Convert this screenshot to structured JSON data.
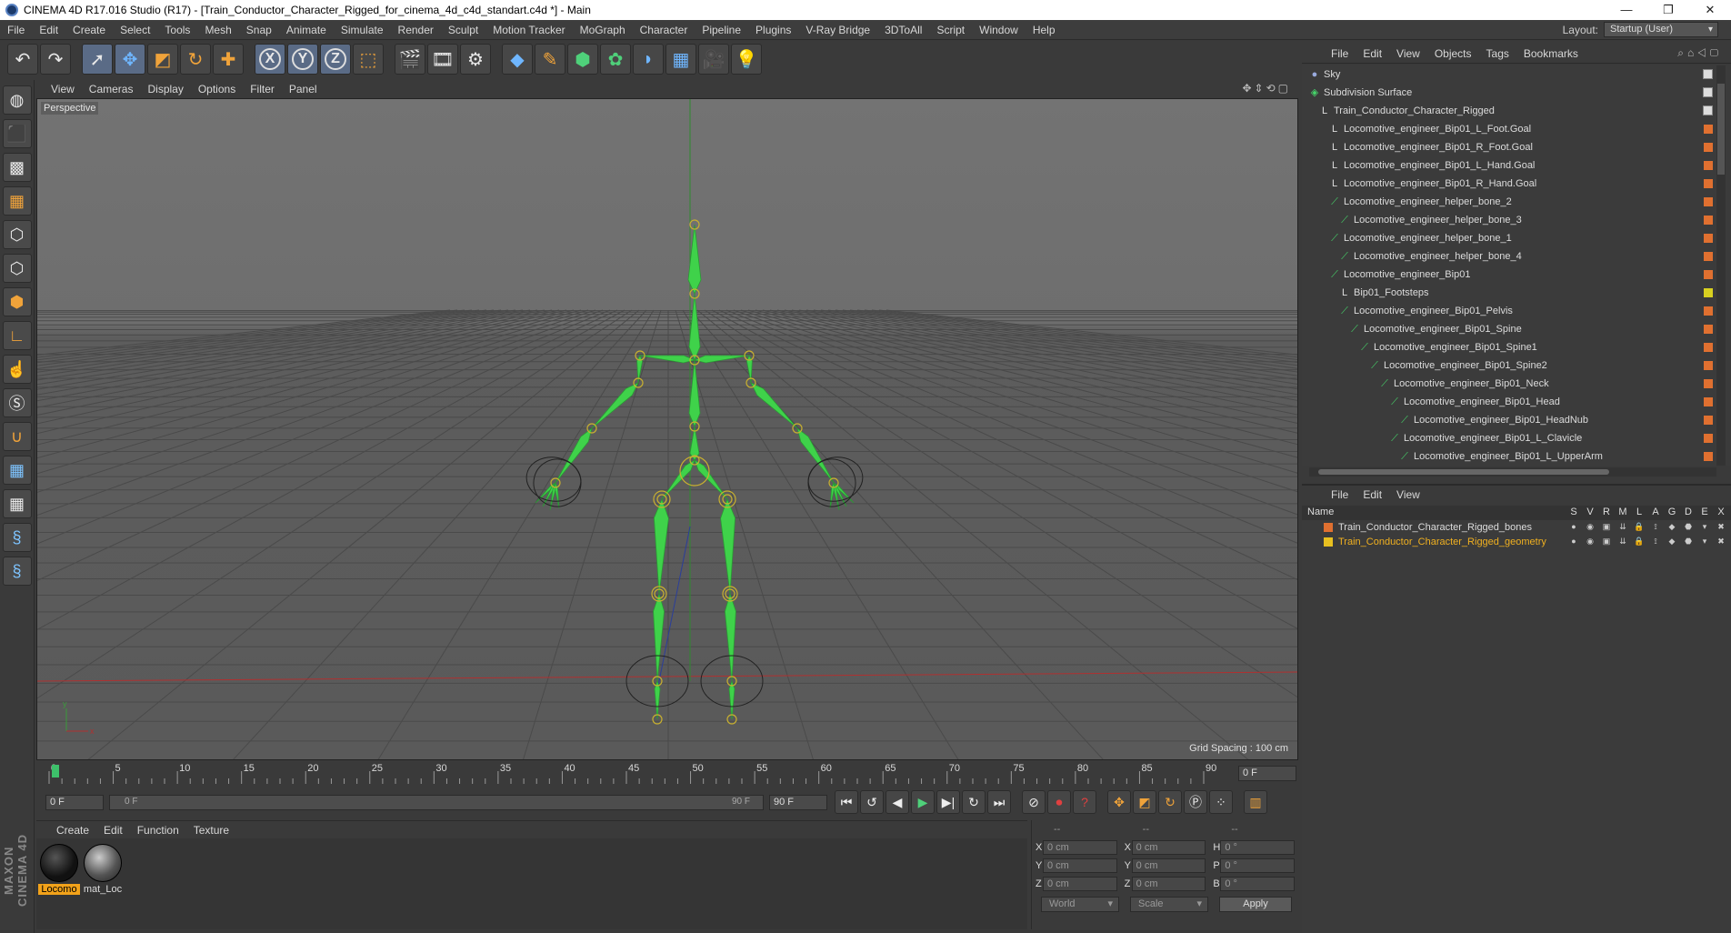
{
  "window": {
    "title": "CINEMA 4D R17.016 Studio (R17) - [Train_Conductor_Character_Rigged_for_cinema_4d_c4d_standart.c4d *] - Main",
    "controls": [
      "—",
      "❐",
      "✕"
    ]
  },
  "menubar": {
    "items": [
      "File",
      "Edit",
      "Create",
      "Select",
      "Tools",
      "Mesh",
      "Snap",
      "Animate",
      "Simulate",
      "Render",
      "Sculpt",
      "Motion Tracker",
      "MoGraph",
      "Character",
      "Pipeline",
      "Plugins",
      "V-Ray Bridge",
      "3DToAll",
      "Script",
      "Window",
      "Help"
    ],
    "layout_label": "Layout:",
    "layout_value": "Startup (User)"
  },
  "toolbar": {
    "icons": [
      "undo-icon",
      "redo-icon",
      "live-selection-icon",
      "move-icon",
      "scale-icon",
      "rotate-icon",
      "add-icon",
      "x-axis-icon",
      "y-axis-icon",
      "z-axis-icon",
      "coordinate-system-icon",
      "render-view-icon",
      "render-picture-viewer-icon",
      "edit-render-settings-icon",
      "cube-icon",
      "pen-icon",
      "subdivision-icon",
      "mograph-cloner-icon",
      "deformer-icon",
      "floor-icon",
      "camera-icon",
      "light-icon"
    ],
    "axis_labels": [
      "X",
      "Y",
      "Z"
    ]
  },
  "viewport": {
    "menu": [
      "View",
      "Cameras",
      "Display",
      "Options",
      "Filter",
      "Panel"
    ],
    "label": "Perspective",
    "grid_spacing": "Grid Spacing : 100 cm"
  },
  "timeline": {
    "ticks": [
      "0",
      "5",
      "10",
      "15",
      "20",
      "25",
      "30",
      "35",
      "40",
      "45",
      "50",
      "55",
      "60",
      "65",
      "70",
      "75",
      "80",
      "85",
      "90"
    ],
    "current_frame": "0 F",
    "start": "0 F",
    "range_start": "0 F",
    "range_end": "90 F",
    "end": "90 F"
  },
  "materials": {
    "menu": [
      "Create",
      "Edit",
      "Function",
      "Texture"
    ],
    "items": [
      {
        "name": "Locomo",
        "selected": true,
        "color": "#1a1a1a"
      },
      {
        "name": "mat_Loc",
        "selected": false,
        "color": "#777777"
      }
    ]
  },
  "coordinates": {
    "headers": [
      "--",
      "--",
      "--"
    ],
    "rows": [
      {
        "a1": "X",
        "v1": "0 cm",
        "a2": "X",
        "v2": "0 cm",
        "a3": "H",
        "v3": "0 °"
      },
      {
        "a1": "Y",
        "v1": "0 cm",
        "a2": "Y",
        "v2": "0 cm",
        "a3": "P",
        "v3": "0 °"
      },
      {
        "a1": "Z",
        "v1": "0 cm",
        "a2": "Z",
        "v2": "0 cm",
        "a3": "B",
        "v3": "0 °"
      }
    ],
    "world": "World",
    "scale": "Scale",
    "apply": "Apply"
  },
  "object_manager": {
    "menu": [
      "File",
      "Edit",
      "View",
      "Objects",
      "Tags",
      "Bookmarks"
    ],
    "objects": [
      {
        "name": "Sky",
        "indent": 0,
        "icon": "sky",
        "tag": "check"
      },
      {
        "name": "Subdivision Surface",
        "indent": 0,
        "icon": "sds",
        "tag": "check"
      },
      {
        "name": "Train_Conductor_Character_Rigged",
        "indent": 1,
        "icon": "null",
        "tag": "check"
      },
      {
        "name": "Locomotive_engineer_Bip01_L_Foot.Goal",
        "indent": 2,
        "icon": "null",
        "tag": "#e07030"
      },
      {
        "name": "Locomotive_engineer_Bip01_R_Foot.Goal",
        "indent": 2,
        "icon": "null",
        "tag": "#e07030"
      },
      {
        "name": "Locomotive_engineer_Bip01_L_Hand.Goal",
        "indent": 2,
        "icon": "null",
        "tag": "#e07030"
      },
      {
        "name": "Locomotive_engineer_Bip01_R_Hand.Goal",
        "indent": 2,
        "icon": "null",
        "tag": "#e07030"
      },
      {
        "name": "Locomotive_engineer_helper_bone_2",
        "indent": 2,
        "icon": "bone",
        "tag": "#e07030"
      },
      {
        "name": "Locomotive_engineer_helper_bone_3",
        "indent": 3,
        "icon": "bone",
        "tag": "#e07030"
      },
      {
        "name": "Locomotive_engineer_helper_bone_1",
        "indent": 2,
        "icon": "bone",
        "tag": "#e07030"
      },
      {
        "name": "Locomotive_engineer_helper_bone_4",
        "indent": 3,
        "icon": "bone",
        "tag": "#e07030"
      },
      {
        "name": "Locomotive_engineer_Bip01",
        "indent": 2,
        "icon": "bone",
        "tag": "#e07030"
      },
      {
        "name": "Bip01_Footsteps",
        "indent": 3,
        "icon": "null",
        "tag": "#d8d020"
      },
      {
        "name": "Locomotive_engineer_Bip01_Pelvis",
        "indent": 3,
        "icon": "bone",
        "tag": "#e07030"
      },
      {
        "name": "Locomotive_engineer_Bip01_Spine",
        "indent": 4,
        "icon": "bone",
        "tag": "#e07030"
      },
      {
        "name": "Locomotive_engineer_Bip01_Spine1",
        "indent": 5,
        "icon": "bone",
        "tag": "#e07030"
      },
      {
        "name": "Locomotive_engineer_Bip01_Spine2",
        "indent": 6,
        "icon": "bone",
        "tag": "#e07030"
      },
      {
        "name": "Locomotive_engineer_Bip01_Neck",
        "indent": 7,
        "icon": "bone",
        "tag": "#e07030"
      },
      {
        "name": "Locomotive_engineer_Bip01_Head",
        "indent": 8,
        "icon": "bone",
        "tag": "#e07030"
      },
      {
        "name": "Locomotive_engineer_Bip01_HeadNub",
        "indent": 9,
        "icon": "bone",
        "tag": "#e07030"
      },
      {
        "name": "Locomotive_engineer_Bip01_L_Clavicle",
        "indent": 8,
        "icon": "bone",
        "tag": "#e07030"
      },
      {
        "name": "Locomotive_engineer_Bip01_L_UpperArm",
        "indent": 9,
        "icon": "bone",
        "tag": "#e07030"
      }
    ]
  },
  "layer_manager": {
    "menu": [
      "File",
      "Edit",
      "View"
    ],
    "name_header": "Name",
    "columns": [
      "S",
      "V",
      "R",
      "M",
      "L",
      "A",
      "G",
      "D",
      "E",
      "X"
    ],
    "layers": [
      {
        "name": "Train_Conductor_Character_Rigged_bones",
        "color": "#e07030",
        "text_color": "#dcdcdc"
      },
      {
        "name": "Train_Conductor_Character_Rigged_geometry",
        "color": "#e8c020",
        "text_color": "#f0b020"
      }
    ]
  },
  "branding": {
    "text": "MAXON CINEMA 4D"
  }
}
